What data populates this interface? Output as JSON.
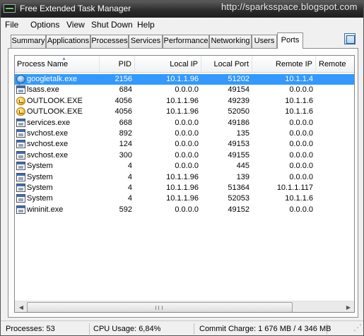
{
  "window": {
    "title": "Free Extended Task Manager",
    "watermark": "http://sparksspace.blogspot.com"
  },
  "menu": [
    "File",
    "Options",
    "View",
    "Shut Down",
    "Help"
  ],
  "tabs": [
    "Summary",
    "Applications",
    "Processes",
    "Services",
    "Performance",
    "Networking",
    "Users",
    "Ports"
  ],
  "active_tab": "Ports",
  "table": {
    "columns": [
      "Process Name",
      "PID",
      "Local IP",
      "Local Port",
      "Remote IP",
      "Remote"
    ],
    "sort_column": "Process Name",
    "rows": [
      {
        "icon": "googletalk-icon",
        "name": "googletalk.exe",
        "pid": "2156",
        "local_ip": "10.1.1.96",
        "local_port": "51202",
        "remote_ip": "10.1.1.4",
        "selected": true
      },
      {
        "icon": "exe-icon",
        "name": "lsass.exe",
        "pid": "684",
        "local_ip": "0.0.0.0",
        "local_port": "49154",
        "remote_ip": "0.0.0.0"
      },
      {
        "icon": "outlook-icon",
        "name": "OUTLOOK.EXE",
        "pid": "4056",
        "local_ip": "10.1.1.96",
        "local_port": "49239",
        "remote_ip": "10.1.1.6"
      },
      {
        "icon": "outlook-icon",
        "name": "OUTLOOK.EXE",
        "pid": "4056",
        "local_ip": "10.1.1.96",
        "local_port": "52050",
        "remote_ip": "10.1.1.6"
      },
      {
        "icon": "exe-icon",
        "name": "services.exe",
        "pid": "668",
        "local_ip": "0.0.0.0",
        "local_port": "49186",
        "remote_ip": "0.0.0.0"
      },
      {
        "icon": "exe-icon",
        "name": "svchost.exe",
        "pid": "892",
        "local_ip": "0.0.0.0",
        "local_port": "135",
        "remote_ip": "0.0.0.0"
      },
      {
        "icon": "exe-icon",
        "name": "svchost.exe",
        "pid": "124",
        "local_ip": "0.0.0.0",
        "local_port": "49153",
        "remote_ip": "0.0.0.0"
      },
      {
        "icon": "exe-icon",
        "name": "svchost.exe",
        "pid": "300",
        "local_ip": "0.0.0.0",
        "local_port": "49155",
        "remote_ip": "0.0.0.0"
      },
      {
        "icon": "exe-icon",
        "name": "System",
        "pid": "4",
        "local_ip": "0.0.0.0",
        "local_port": "445",
        "remote_ip": "0.0.0.0"
      },
      {
        "icon": "exe-icon",
        "name": "System",
        "pid": "4",
        "local_ip": "10.1.1.96",
        "local_port": "139",
        "remote_ip": "0.0.0.0"
      },
      {
        "icon": "exe-icon",
        "name": "System",
        "pid": "4",
        "local_ip": "10.1.1.96",
        "local_port": "51364",
        "remote_ip": "10.1.1.117"
      },
      {
        "icon": "exe-icon",
        "name": "System",
        "pid": "4",
        "local_ip": "10.1.1.96",
        "local_port": "52053",
        "remote_ip": "10.1.1.6"
      },
      {
        "icon": "exe-icon",
        "name": "wininit.exe",
        "pid": "592",
        "local_ip": "0.0.0.0",
        "local_port": "49152",
        "remote_ip": "0.0.0.0"
      }
    ]
  },
  "status": {
    "processes": "Processes: 53",
    "cpu": "CPU Usage: 6,84%",
    "commit": "Commit Charge: 1 676 MB / 4 346 MB"
  }
}
